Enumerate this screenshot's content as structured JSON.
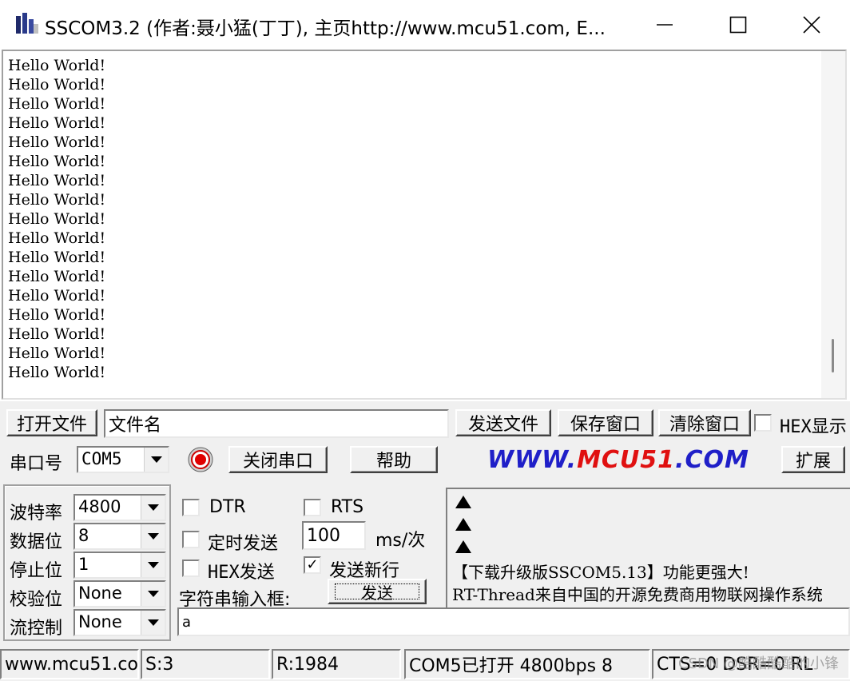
{
  "window": {
    "title": "SSCOM3.2 (作者:聂小猛(丁丁), 主页http://www.mcu51.com,  E...",
    "minimize_icon": "minimize-icon",
    "maximize_icon": "maximize-icon",
    "close_icon": "close-icon"
  },
  "receive": {
    "lines": [
      "Hello World!",
      "Hello World!",
      "Hello World!",
      "Hello World!",
      "Hello World!",
      "Hello World!",
      "Hello World!",
      "Hello World!",
      "Hello World!",
      "Hello World!",
      "Hello World!",
      "Hello World!",
      "Hello World!",
      "Hello World!",
      "Hello World!",
      "Hello World!",
      "Hello World!"
    ]
  },
  "toolbar": {
    "open_file": "打开文件",
    "file_name": "文件名",
    "send_file": "发送文件",
    "save_window": "保存窗口",
    "clear_window": "清除窗口",
    "hex_display": "HEX显示"
  },
  "port_row": {
    "port_label": "串口号",
    "port_value": "COM5",
    "close_port": "关闭串口",
    "help": "帮助",
    "brand_1": "WWW.",
    "brand_2": "MCU51",
    "brand_3": ".COM",
    "expand": "扩展"
  },
  "settings": {
    "baud_label": "波特率",
    "baud_value": "4800",
    "data_label": "数据位",
    "data_value": "8",
    "stop_label": "停止位",
    "stop_value": "1",
    "parity_label": "校验位",
    "parity_value": "None",
    "flow_label": "流控制",
    "flow_value": "None"
  },
  "options": {
    "dtr": "DTR",
    "rts": "RTS",
    "timed_send": "定时发送",
    "interval": "100",
    "interval_unit": "ms/次",
    "hex_send": "HEX发送",
    "send_newline": "发送新行",
    "send_newline_checked": "✓",
    "input_label": "字符串输入框:",
    "send_button": "发送",
    "input_value": "a"
  },
  "notice": {
    "line1": "【下载升级版SSCOM5.13】功能更强大!",
    "line2": "RT-Thread来自中国的开源免费商用物联网操作系统"
  },
  "status": {
    "site": "www.mcu51.com",
    "sent": "S:3",
    "received": "R:1984",
    "port_state": "COM5已打开  4800bps  8",
    "signals": "CTS=0 DSR=0 RL",
    "watermark": "CSDN @酷酷酷酷的小锋"
  },
  "colors": {
    "brand_blue": "#1f1fc8",
    "brand_red": "#e01010",
    "panel_bg": "#f0f0f0"
  }
}
